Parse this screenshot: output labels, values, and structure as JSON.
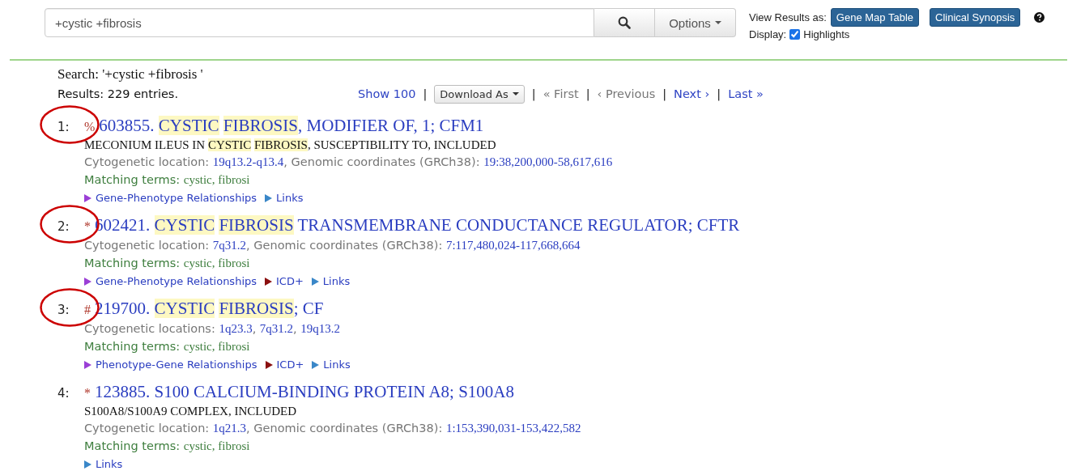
{
  "search": {
    "value": "+cystic +fibrosis",
    "options_label": "Options"
  },
  "view_results": {
    "label": "View Results as:",
    "buttons": [
      "Gene Map Table",
      "Clinical Synopsis"
    ]
  },
  "display": {
    "label": "Display:",
    "highlights": {
      "label": "Highlights",
      "checked": true
    }
  },
  "summary": {
    "search": "Search: '+cystic +fibrosis '",
    "results": "Results: 229 entries."
  },
  "pager": [
    {
      "kind": "link",
      "label": "Show 100",
      "disabled": false
    },
    {
      "kind": "separator",
      "label": "|"
    },
    {
      "kind": "dropdown",
      "label": "Download As"
    },
    {
      "kind": "separator",
      "label": "|"
    },
    {
      "kind": "link",
      "label": "« First",
      "disabled": true
    },
    {
      "kind": "separator",
      "label": "|"
    },
    {
      "kind": "link",
      "label": "‹ Previous",
      "disabled": true
    },
    {
      "kind": "separator",
      "label": "|"
    },
    {
      "kind": "link",
      "label": "Next ›",
      "disabled": false
    },
    {
      "kind": "separator",
      "label": "|"
    },
    {
      "kind": "link",
      "label": "Last »",
      "disabled": false
    }
  ],
  "entries": [
    {
      "number": "1:",
      "circled": true,
      "symbol": "%",
      "title": [
        {
          "text": "603855. ",
          "highlighted": false
        },
        {
          "text": "CYSTIC ",
          "highlighted": true
        },
        {
          "text": "FIBROSIS",
          "highlighted": true
        },
        {
          "text": ", MODIFIER OF, 1; CFM1",
          "highlighted": false
        }
      ],
      "included": [
        {
          "text": "MECONIUM ILEUS IN ",
          "highlighted": false
        },
        {
          "text": "CYSTIC ",
          "highlighted": true
        },
        {
          "text": "FIBROSIS",
          "highlighted": true
        },
        {
          "text": ", SUSCEPTIBILITY TO, INCLUDED",
          "highlighted": false
        }
      ],
      "location": [
        {
          "text": "Cytogenetic location: ",
          "link": false
        },
        {
          "text": "19q13.2-q13.4",
          "link": true
        },
        {
          "text": ", Genomic coordinates (GRCh38): ",
          "link": false
        },
        {
          "text": "19:38,200,000-58,617,616",
          "link": true
        }
      ],
      "matching": {
        "label": "Matching terms:",
        "terms": "cystic, fibrosi"
      },
      "actions": [
        {
          "label": "Gene-Phenotype Relationships",
          "color": "#9b3fd6"
        },
        {
          "label": "Links",
          "color": "#3a87c8"
        }
      ]
    },
    {
      "number": "2:",
      "circled": true,
      "symbol": "*",
      "title": [
        {
          "text": "602421. ",
          "highlighted": false
        },
        {
          "text": "CYSTIC ",
          "highlighted": true
        },
        {
          "text": "FIBROSIS",
          "highlighted": true
        },
        {
          "text": " TRANSMEMBRANE CONDUCTANCE REGULATOR; CFTR",
          "highlighted": false
        }
      ],
      "location": [
        {
          "text": "Cytogenetic location: ",
          "link": false
        },
        {
          "text": "7q31.2",
          "link": true
        },
        {
          "text": ", Genomic coordinates (GRCh38): ",
          "link": false
        },
        {
          "text": "7:117,480,024-117,668,664",
          "link": true
        }
      ],
      "matching": {
        "label": "Matching terms:",
        "terms": "cystic, fibrosi"
      },
      "actions": [
        {
          "label": "Gene-Phenotype Relationships",
          "color": "#9b3fd6"
        },
        {
          "label": "ICD+",
          "color": "#8b1010"
        },
        {
          "label": "Links",
          "color": "#3a87c8"
        }
      ]
    },
    {
      "number": "3:",
      "circled": true,
      "symbol": "#",
      "title": [
        {
          "text": "219700. ",
          "highlighted": false
        },
        {
          "text": "CYSTIC ",
          "highlighted": true
        },
        {
          "text": "FIBROSIS",
          "highlighted": true
        },
        {
          "text": "; CF",
          "highlighted": false
        }
      ],
      "location": [
        {
          "text": "Cytogenetic locations: ",
          "link": false
        },
        {
          "text": "1q23.3",
          "link": true
        },
        {
          "text": ", ",
          "link": false
        },
        {
          "text": "7q31.2",
          "link": true
        },
        {
          "text": ", ",
          "link": false
        },
        {
          "text": "19q13.2",
          "link": true
        }
      ],
      "matching": {
        "label": "Matching terms:",
        "terms": "cystic, fibrosi"
      },
      "actions": [
        {
          "label": "Phenotype-Gene Relationships",
          "color": "#9b3fd6"
        },
        {
          "label": "ICD+",
          "color": "#8b1010"
        },
        {
          "label": "Links",
          "color": "#3a87c8"
        }
      ]
    },
    {
      "number": "4:",
      "circled": false,
      "symbol": "*",
      "title": [
        {
          "text": "123885. S100 CALCIUM-BINDING PROTEIN A8; S100A8",
          "highlighted": false
        }
      ],
      "included": [
        {
          "text": "S100A8/S100A9 COMPLEX, INCLUDED",
          "highlighted": false
        }
      ],
      "location": [
        {
          "text": "Cytogenetic location: ",
          "link": false
        },
        {
          "text": "1q21.3",
          "link": true
        },
        {
          "text": ", Genomic coordinates (GRCh38): ",
          "link": false
        },
        {
          "text": "1:153,390,031-153,422,582",
          "link": true
        }
      ],
      "matching": {
        "label": "Matching terms:",
        "terms": "cystic, fibrosi"
      },
      "actions": [
        {
          "label": "Links",
          "color": "#3a87c8"
        }
      ]
    }
  ]
}
